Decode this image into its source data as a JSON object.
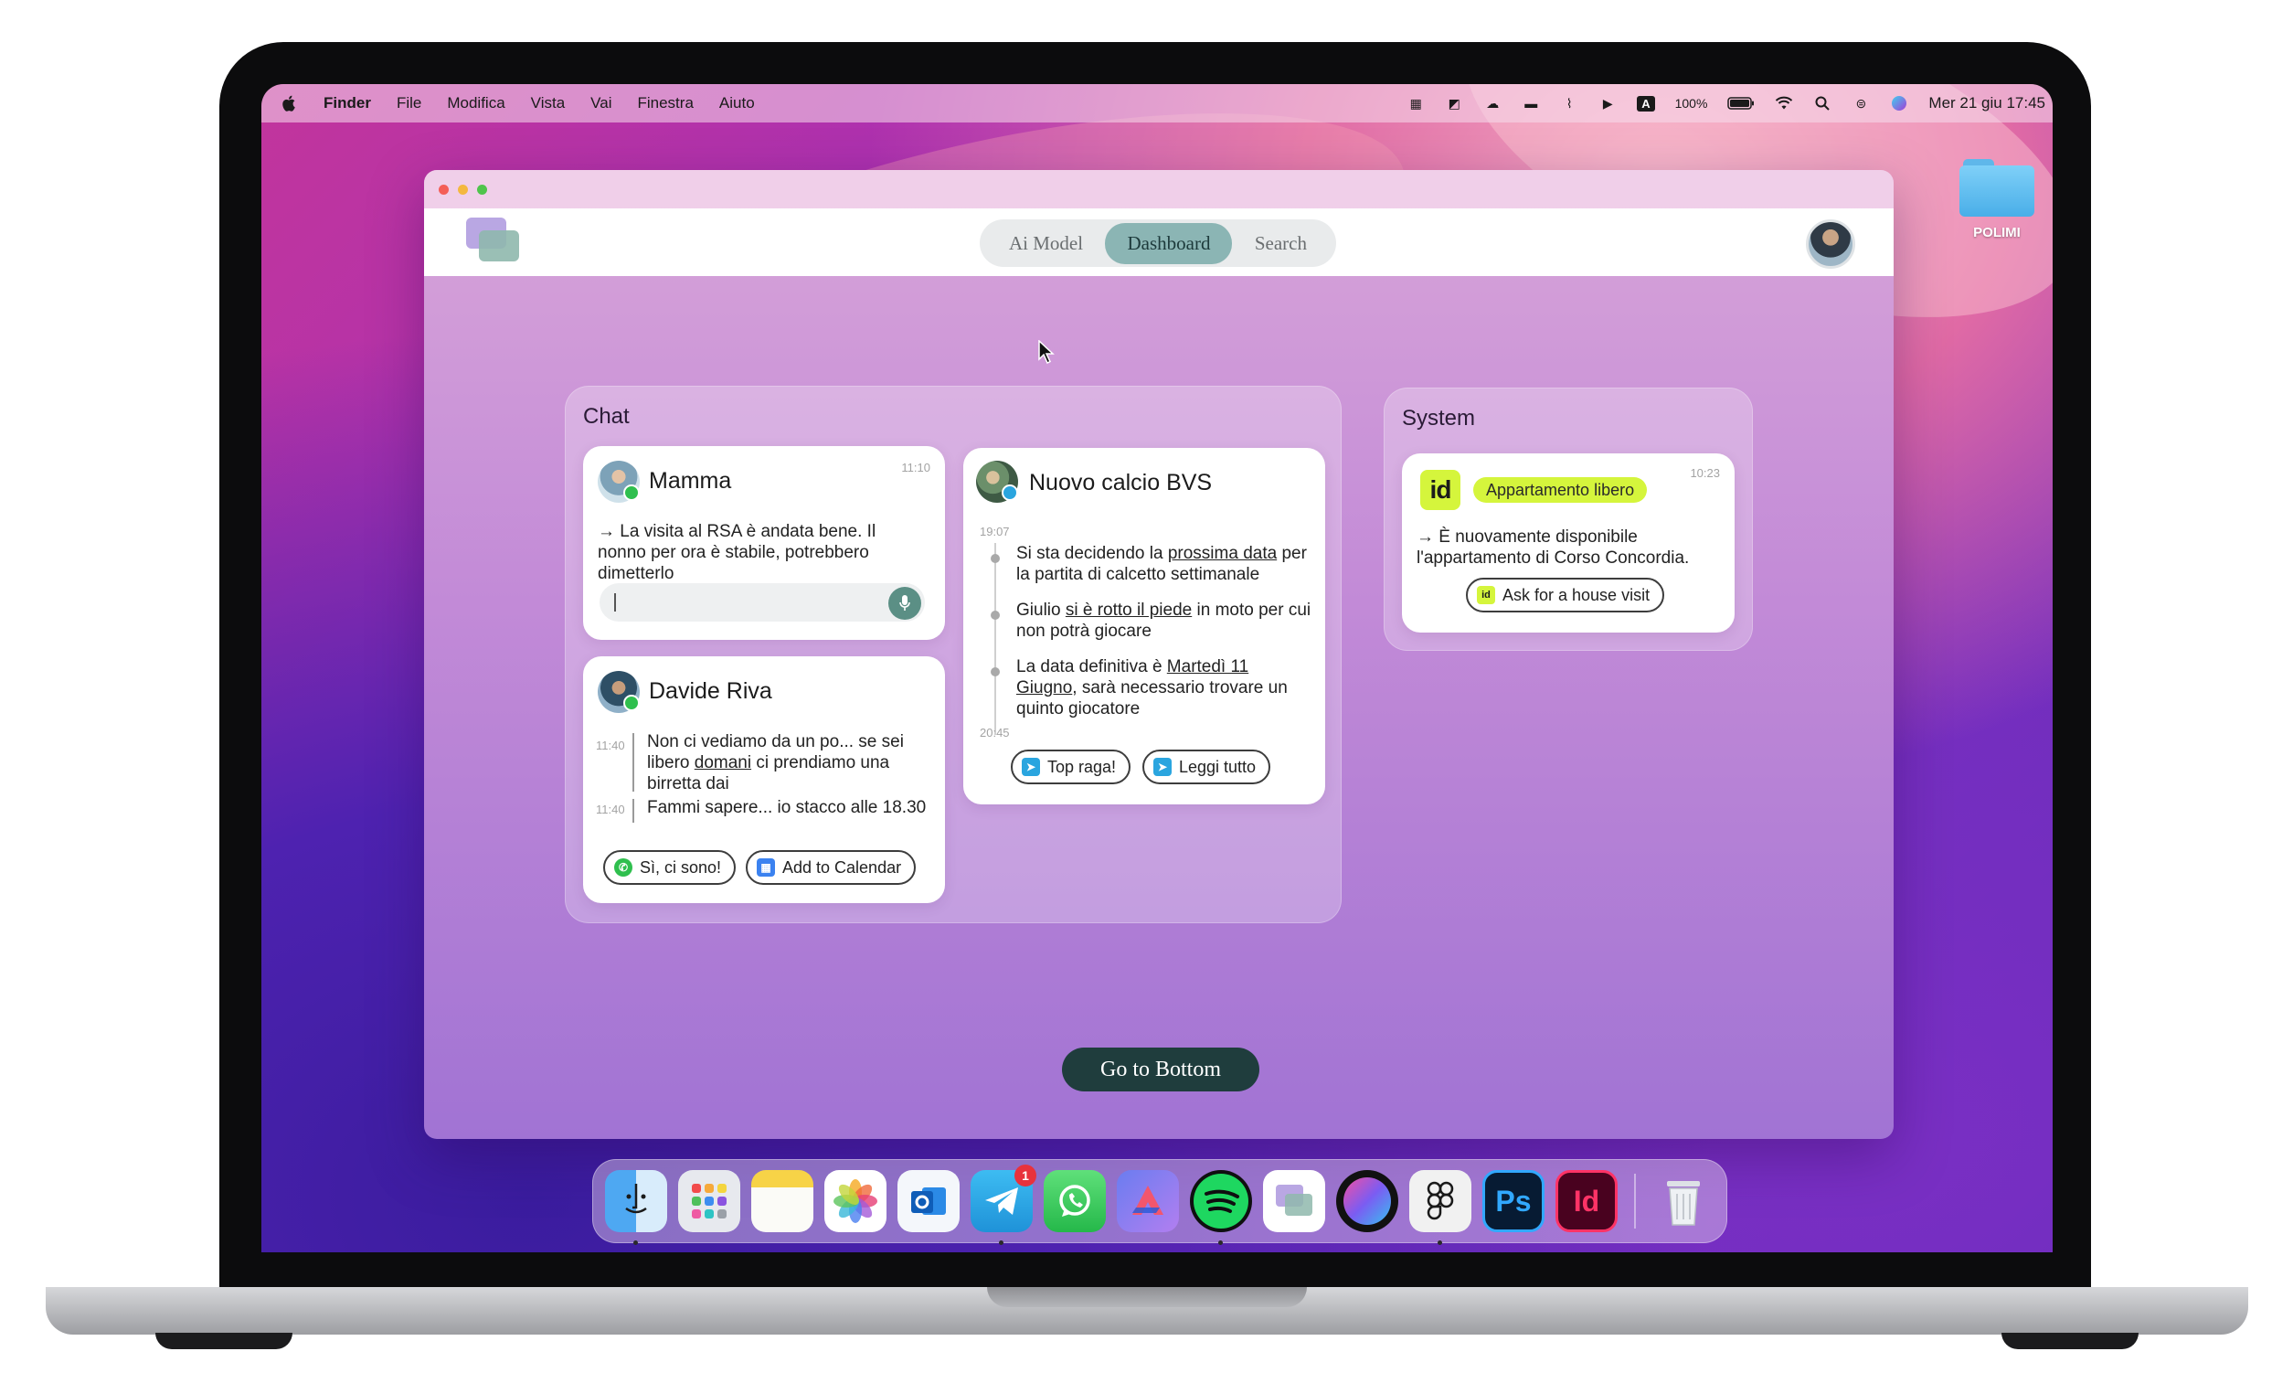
{
  "menubar": {
    "app": "Finder",
    "items": [
      "File",
      "Modifica",
      "Vista",
      "Vai",
      "Finestra",
      "Aiuto"
    ],
    "input_source": "A",
    "battery": "100%",
    "clock": "Mer 21 giu  17:45"
  },
  "desktop": {
    "folder_label": "POLIMI"
  },
  "app": {
    "tabs": [
      "Ai Model",
      "Dashboard",
      "Search"
    ],
    "active_tab": "Dashboard",
    "go_bottom_label": "Go to Bottom"
  },
  "chat_panel": {
    "title": "Chat",
    "mamma": {
      "name": "Mamma",
      "time": "11:10",
      "message": "→ La visita al RSA è andata bene. Il nonno per ora è stabile, potrebbero dimetterlo",
      "input_value": ""
    },
    "davide": {
      "name": "Davide Riva",
      "messages": [
        {
          "time": "11:40",
          "pre": "Non ci vediamo da un po... se sei libero ",
          "link": "domani",
          "post": " ci prendiamo una birretta dai"
        },
        {
          "time": "11:40",
          "pre": "Fammi sapere... io stacco alle 18.30",
          "link": "",
          "post": ""
        }
      ],
      "actions": [
        "Sì, ci sono!",
        "Add to Calendar"
      ]
    },
    "group": {
      "name": "Nuovo calcio BVS",
      "time_start": "19:07",
      "time_end": "20:45",
      "items": [
        {
          "pre": "Si sta decidendo la ",
          "link": "prossima data",
          "post": " per la partita di calcetto settimanale"
        },
        {
          "pre": "Giulio ",
          "link": "si è rotto il piede",
          "post": " in moto per cui non potrà giocare"
        },
        {
          "pre": "La data definitiva è ",
          "link": "Martedì 11 Giugno",
          "post": ", sarà necessario trovare un quinto giocatore"
        }
      ],
      "actions": [
        "Top raga!",
        "Leggi tutto"
      ]
    }
  },
  "system_panel": {
    "title": "System",
    "card": {
      "logo": "id",
      "tag": "Appartamento libero",
      "time": "10:23",
      "message": "→ È nuovamente disponibile l'appartamento di Corso Concordia.",
      "action_badge": "id",
      "action": "Ask for a house visit"
    }
  },
  "dock": {
    "apps": [
      "Finder",
      "Launchpad",
      "Notes",
      "Photos",
      "Outlook",
      "Telegram",
      "WhatsApp",
      "Affinity",
      "Spotify",
      "Dashboard App",
      "Arc",
      "Figma",
      "Photoshop",
      "InDesign",
      "Trash"
    ],
    "ps_label": "Ps",
    "id_label": "Id",
    "telegram_badge": "1"
  }
}
